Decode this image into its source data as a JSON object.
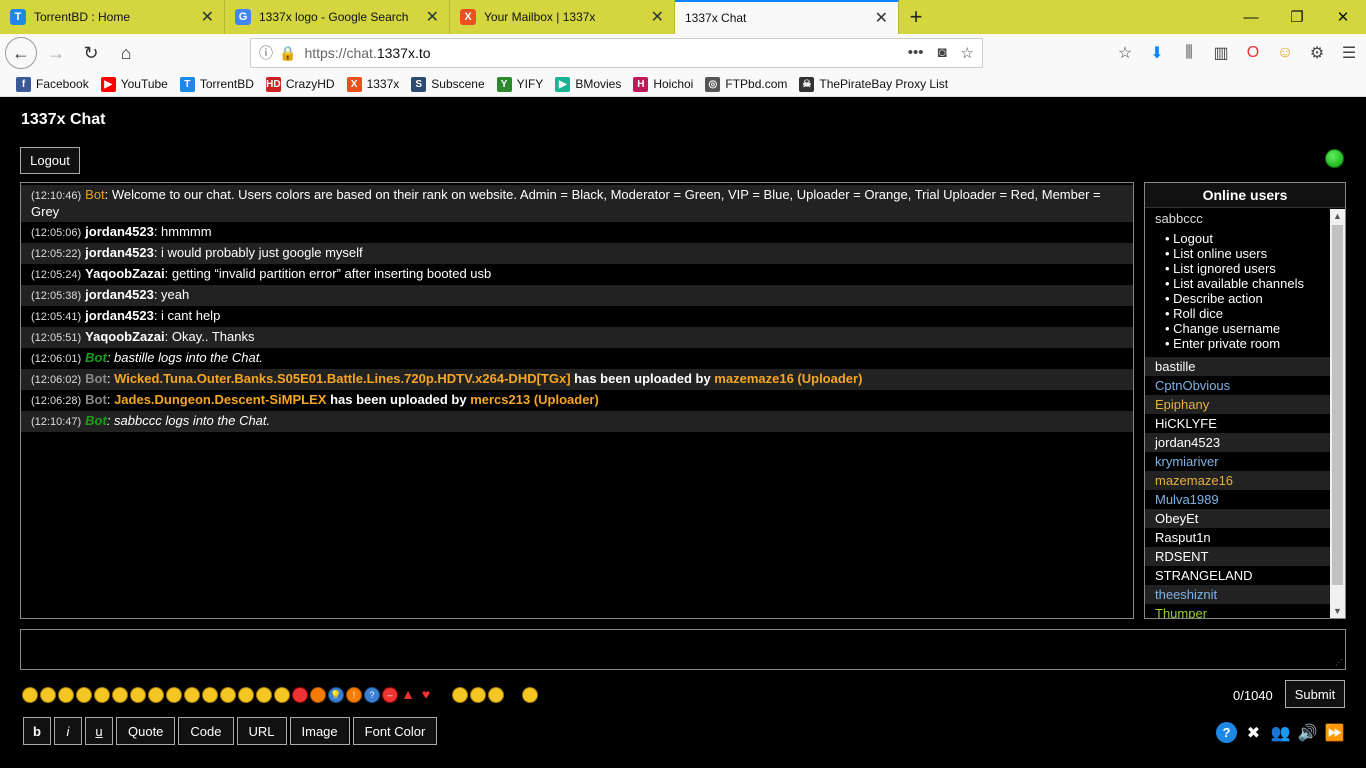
{
  "browser": {
    "tabs": [
      {
        "title": "TorrentBD : Home",
        "fav": "T",
        "fav_color": "#1e88e5",
        "active": false
      },
      {
        "title": "1337x logo - Google Search",
        "fav": "G",
        "fav_color": "#4285f4",
        "active": false
      },
      {
        "title": "Your Mailbox | 1337x",
        "fav": "X",
        "fav_color": "#e8501d",
        "active": false
      },
      {
        "title": "1337x Chat",
        "fav": "",
        "fav_color": "",
        "active": true
      }
    ],
    "url_prefix": "https://chat.",
    "url_domain": "1337x.to",
    "bookmarks": [
      {
        "label": "Facebook",
        "color": "#3b5998",
        "glyph": "f"
      },
      {
        "label": "YouTube",
        "color": "#ff0000",
        "glyph": "▶"
      },
      {
        "label": "TorrentBD",
        "color": "#1e88e5",
        "glyph": "T"
      },
      {
        "label": "CrazyHD",
        "color": "#cc2222",
        "glyph": "HD"
      },
      {
        "label": "1337x",
        "color": "#e8501d",
        "glyph": "X"
      },
      {
        "label": "Subscene",
        "color": "#2b4b6f",
        "glyph": "S"
      },
      {
        "label": "YIFY",
        "color": "#2c8a2c",
        "glyph": "Y"
      },
      {
        "label": "BMovies",
        "color": "#1ab394",
        "glyph": "▶"
      },
      {
        "label": "Hoichoi",
        "color": "#c2185b",
        "glyph": "H"
      },
      {
        "label": "FTPbd.com",
        "color": "#555555",
        "glyph": "◎"
      },
      {
        "label": "ThePirateBay Proxy List",
        "color": "#333333",
        "glyph": "☠"
      }
    ]
  },
  "page": {
    "title": "1337x Chat",
    "logout_label": "Logout"
  },
  "chat": {
    "messages": [
      {
        "time": "(12:10:46)",
        "user": "Bot",
        "user_style": "bot-orange",
        "text": ": Welcome to our chat. Users colors are based on their rank on website. Admin = Black, Moderator = Green, VIP = Blue, Uploader = Orange, Trial Uploader = Red, Member = Grey",
        "alt": true
      },
      {
        "time": "(12:05:06)",
        "user": "jordan4523",
        "user_style": "user",
        "text": ": hmmmm",
        "alt": false
      },
      {
        "time": "(12:05:22)",
        "user": "jordan4523",
        "user_style": "user",
        "text": ": i would probably just google myself",
        "alt": true
      },
      {
        "time": "(12:05:24)",
        "user": "YaqoobZazai",
        "user_style": "user",
        "text": ": getting “invalid partition error” after inserting booted usb",
        "alt": false
      },
      {
        "time": "(12:05:38)",
        "user": "jordan4523",
        "user_style": "user",
        "text": ": yeah",
        "alt": true
      },
      {
        "time": "(12:05:41)",
        "user": "jordan4523",
        "user_style": "user",
        "text": ": i cant help",
        "alt": false
      },
      {
        "time": "(12:05:51)",
        "user": "YaqoobZazai",
        "user_style": "user",
        "text": ": Okay.. Thanks",
        "alt": true
      },
      {
        "time": "(12:06:01)",
        "user": "Bot",
        "user_style": "bot-green",
        "text": ": bastille logs into the Chat.",
        "italic": true,
        "alt": false
      },
      {
        "time": "(12:06:02)",
        "user": "Bot",
        "user_style": "bot-grey",
        "upload": {
          "name": "Wicked.Tuna.Outer.Banks.S05E01.Battle.Lines.720p.HDTV.x264-DHD[TGx]",
          "mid": " has been uploaded by ",
          "by": "mazemaze16 (Uploader)"
        },
        "alt": true
      },
      {
        "time": "(12:06:28)",
        "user": "Bot",
        "user_style": "bot-grey",
        "upload": {
          "name": "Jades.Dungeon.Descent-SiMPLEX",
          "mid": " has been uploaded by ",
          "by": "mercs213 (Uploader)"
        },
        "alt": false
      },
      {
        "time": "(12:10:47)",
        "user": "Bot",
        "user_style": "bot-green",
        "text": ": sabbccc logs into the Chat.",
        "italic": true,
        "alt": true
      }
    ]
  },
  "online": {
    "heading": "Online users",
    "me": "sabbccc",
    "menu": [
      "Logout",
      "List online users",
      "List ignored users",
      "List available channels",
      "Describe action",
      "Roll dice",
      "Change username",
      "Enter private room"
    ],
    "users": [
      {
        "name": "bastille",
        "color": "#ffffff"
      },
      {
        "name": "CptnObvious",
        "color": "#7fb3e6"
      },
      {
        "name": "Epiphany",
        "color": "#e8b03c"
      },
      {
        "name": "HiCKLYFE",
        "color": "#ffffff"
      },
      {
        "name": "jordan4523",
        "color": "#ffffff"
      },
      {
        "name": "krymiariver",
        "color": "#7fb3e6"
      },
      {
        "name": "mazemaze16",
        "color": "#e8b03c"
      },
      {
        "name": "Mulva1989",
        "color": "#7fb3e6"
      },
      {
        "name": "ObeyEt",
        "color": "#ffffff"
      },
      {
        "name": "Rasput1n",
        "color": "#ffffff"
      },
      {
        "name": "RDSENT",
        "color": "#ffffff"
      },
      {
        "name": "STRANGELAND",
        "color": "#ffffff"
      },
      {
        "name": "theeshiznit",
        "color": "#7fb3e6"
      },
      {
        "name": "Thumper",
        "color": "#9acd32"
      }
    ]
  },
  "composer": {
    "counter": "0/1040",
    "submit_label": "Submit",
    "format_buttons": [
      "b",
      "i",
      "u",
      "Quote",
      "Code",
      "URL",
      "Image",
      "Font Color"
    ]
  }
}
